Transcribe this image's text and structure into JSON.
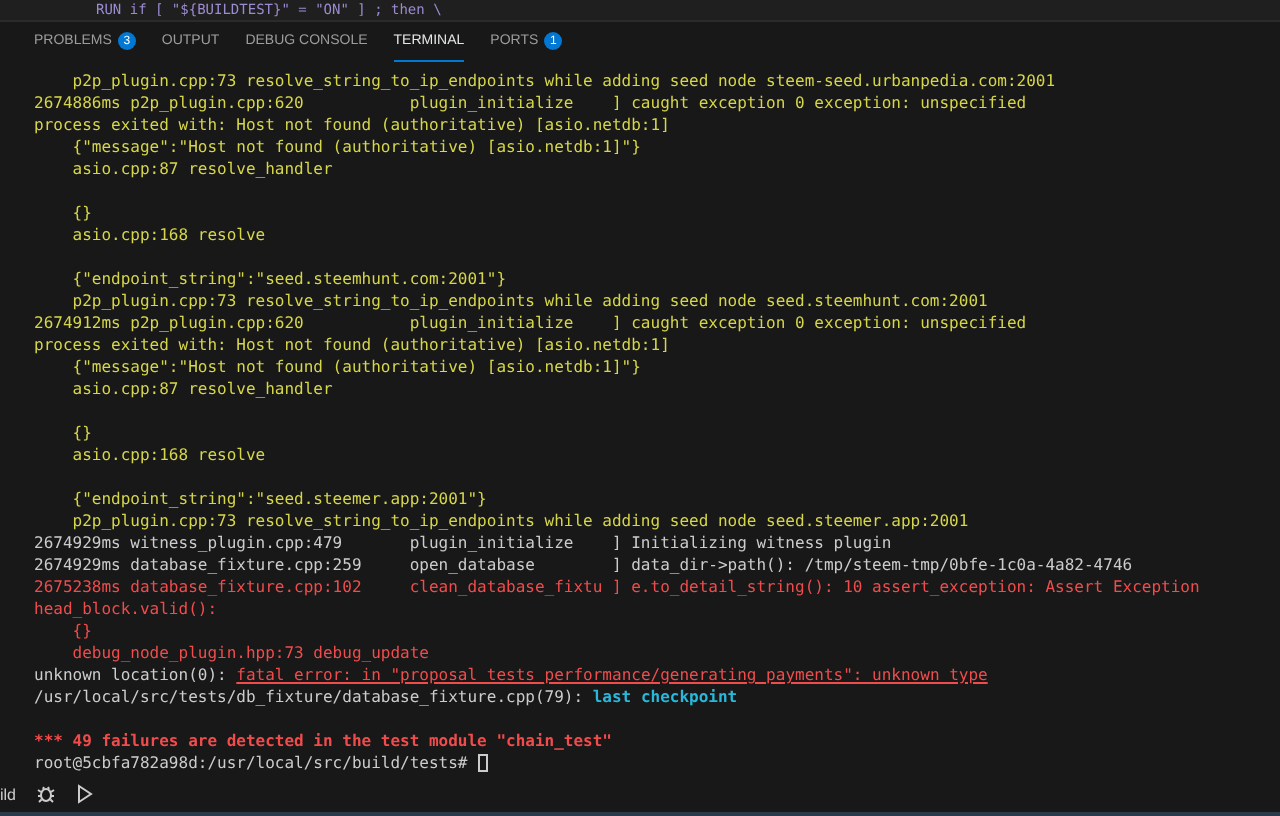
{
  "editor_line": {
    "code": "RUN if [ \"${BUILDTEST}\" = \"ON\" ] ; then \\"
  },
  "tabs": [
    {
      "label": "PROBLEMS",
      "badge": "3",
      "selected": false
    },
    {
      "label": "OUTPUT",
      "selected": false
    },
    {
      "label": "DEBUG CONSOLE",
      "selected": false
    },
    {
      "label": "TERMINAL",
      "selected": true
    },
    {
      "label": "PORTS",
      "badge": "1",
      "selected": false
    }
  ],
  "terminal": {
    "lines": [
      {
        "kind": "text",
        "segments": [
          {
            "text": "    p2p_plugin.cpp:73 resolve_string_to_ip_endpoints while adding seed node steem-seed.urbanpedia.com:2001",
            "kind": "warn"
          }
        ]
      },
      {
        "kind": "text",
        "segments": [
          {
            "text": "2674886ms p2p_plugin.cpp:620           plugin_initialize    ] caught exception 0 exception: unspecified",
            "kind": "warn"
          }
        ]
      },
      {
        "kind": "text",
        "segments": [
          {
            "text": "process exited with: Host not found (authoritative) [asio.netdb:1]",
            "kind": "warn"
          }
        ]
      },
      {
        "kind": "text",
        "segments": [
          {
            "text": "    {\"message\":\"Host not found (authoritative) [asio.netdb:1]\"}",
            "kind": "warn"
          }
        ]
      },
      {
        "kind": "text",
        "segments": [
          {
            "text": "    asio.cpp:87 resolve_handler",
            "kind": "warn"
          }
        ]
      },
      {
        "kind": "blank"
      },
      {
        "kind": "text",
        "segments": [
          {
            "text": "    {}",
            "kind": "warn"
          }
        ]
      },
      {
        "kind": "text",
        "segments": [
          {
            "text": "    asio.cpp:168 resolve",
            "kind": "warn"
          }
        ]
      },
      {
        "kind": "blank"
      },
      {
        "kind": "text",
        "segments": [
          {
            "text": "    {\"endpoint_string\":\"seed.steemhunt.com:2001\"}",
            "kind": "warn"
          }
        ]
      },
      {
        "kind": "text",
        "segments": [
          {
            "text": "    p2p_plugin.cpp:73 resolve_string_to_ip_endpoints while adding seed node seed.steemhunt.com:2001",
            "kind": "warn"
          }
        ]
      },
      {
        "kind": "text",
        "segments": [
          {
            "text": "2674912ms p2p_plugin.cpp:620           plugin_initialize    ] caught exception 0 exception: unspecified",
            "kind": "warn"
          }
        ]
      },
      {
        "kind": "text",
        "segments": [
          {
            "text": "process exited with: Host not found (authoritative) [asio.netdb:1]",
            "kind": "warn"
          }
        ]
      },
      {
        "kind": "text",
        "segments": [
          {
            "text": "    {\"message\":\"Host not found (authoritative) [asio.netdb:1]\"}",
            "kind": "warn"
          }
        ]
      },
      {
        "kind": "text",
        "segments": [
          {
            "text": "    asio.cpp:87 resolve_handler",
            "kind": "warn"
          }
        ]
      },
      {
        "kind": "blank"
      },
      {
        "kind": "text",
        "segments": [
          {
            "text": "    {}",
            "kind": "warn"
          }
        ]
      },
      {
        "kind": "text",
        "segments": [
          {
            "text": "    asio.cpp:168 resolve",
            "kind": "warn"
          }
        ]
      },
      {
        "kind": "blank"
      },
      {
        "kind": "text",
        "segments": [
          {
            "text": "    {\"endpoint_string\":\"seed.steemer.app:2001\"}",
            "kind": "warn"
          }
        ]
      },
      {
        "kind": "text",
        "segments": [
          {
            "text": "    p2p_plugin.cpp:73 resolve_string_to_ip_endpoints while adding seed node seed.steemer.app:2001",
            "kind": "warn"
          }
        ]
      },
      {
        "kind": "text",
        "segments": [
          {
            "text": "2674929ms witness_plugin.cpp:479       plugin_initialize    ] Initializing witness plugin",
            "kind": "plain"
          }
        ]
      },
      {
        "kind": "text",
        "segments": [
          {
            "text": "2674929ms database_fixture.cpp:259     open_database        ] data_dir->path(): /tmp/steem-tmp/0bfe-1c0a-4a82-4746",
            "kind": "plain"
          }
        ]
      },
      {
        "kind": "text",
        "segments": [
          {
            "text": "2675238ms database_fixture.cpp:102     clean_database_fixtu ] e.to_detail_string(): 10 assert_exception: Assert Exception",
            "kind": "error"
          }
        ]
      },
      {
        "kind": "text",
        "segments": [
          {
            "text": "head_block.valid():",
            "kind": "error"
          }
        ]
      },
      {
        "kind": "text",
        "segments": [
          {
            "text": "    {}",
            "kind": "error"
          }
        ]
      },
      {
        "kind": "text",
        "segments": [
          {
            "text": "    debug_node_plugin.hpp:73 debug_update",
            "kind": "error"
          }
        ]
      },
      {
        "kind": "text",
        "segments": [
          {
            "text": "unknown location(0): ",
            "kind": "plain"
          },
          {
            "text": "fatal error: in \"proposal_tests_performance/generating_payments\": unknown type",
            "kind": "link"
          }
        ]
      },
      {
        "kind": "text",
        "segments": [
          {
            "text": "/usr/local/src/tests/db_fixture/database_fixture.cpp(79): ",
            "kind": "plain"
          },
          {
            "text": "last checkpoint",
            "kind": "info"
          }
        ]
      },
      {
        "kind": "blank"
      },
      {
        "kind": "text",
        "segments": [
          {
            "text": "*** 49 failures are detected in the test module \"chain_test\"",
            "kind": "summary"
          }
        ]
      },
      {
        "kind": "prompt",
        "segments": [
          {
            "text": "root@5cbfa782a98d:/usr/local/src/build/tests# ",
            "kind": "plain"
          }
        ]
      }
    ]
  },
  "status_bar": {
    "label": "ild"
  }
}
